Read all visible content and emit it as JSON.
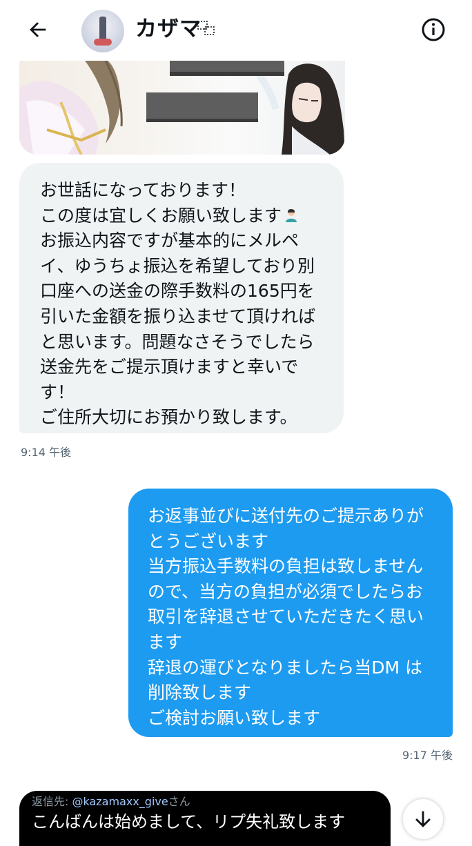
{
  "header": {
    "title": "カザマ",
    "back_icon": "arrow-left-icon",
    "info_icon": "info-circle-icon"
  },
  "messages": [
    {
      "direction": "incoming",
      "lines": [
        "お世話になっております！",
        "この度は宜しくお願い致します",
        "お振込内容ですが基本的にメルペ",
        "イ、ゆうちょ振込を希望しており別",
        "口座への送金の際手数料の165円を",
        "引いた金額を振り込ませて頂ければ",
        "と思います。問題なさそうでしたら",
        "送金先をご提示頂けますと幸いで",
        "す！",
        "ご住所大切にお預かり致します。"
      ],
      "time": "9:14 午後"
    },
    {
      "direction": "outgoing",
      "lines": [
        "お返事並びに送付先のご提示ありが",
        "とうございます",
        "当方振込手数料の負担は致しません",
        "ので、当方の負担が必須でしたらお",
        "取引を辞退させていただきたく思い",
        "ます",
        "辞退の運びとなりましたら当DM は",
        "削除致します",
        "ご検討お願い致します"
      ],
      "time": "9:17 午後"
    }
  ],
  "reply_card": {
    "prefix": "返信先: ",
    "handle": "@kazamaxx_give",
    "suffix": "さん",
    "text": "こんばんは始めまして、リプ失礼致します"
  },
  "colors": {
    "outgoing_bubble": "#1d9bf0",
    "incoming_bubble": "#eff3f4",
    "timestamp": "#536471",
    "reply_card_bg": "#000000"
  }
}
